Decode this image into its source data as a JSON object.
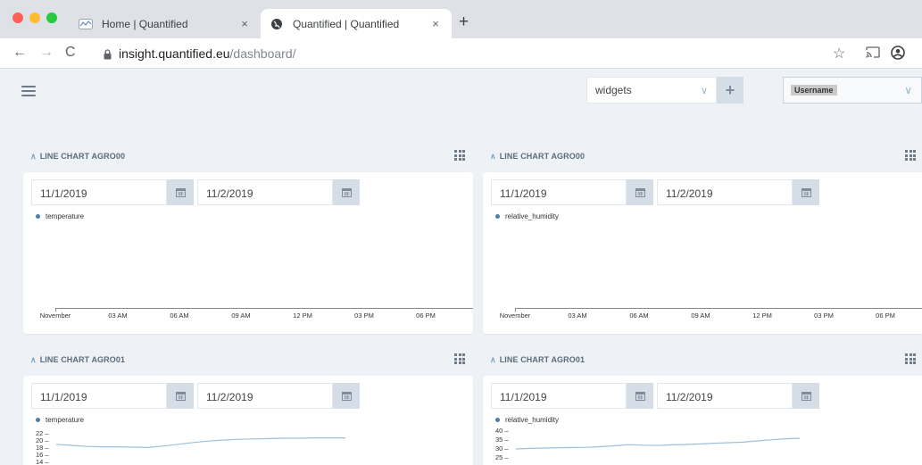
{
  "browser": {
    "tabs": [
      {
        "title": "Home | Quantified",
        "close": "×",
        "active": false
      },
      {
        "title": "Quantified | Quantified",
        "close": "×",
        "active": true
      }
    ],
    "new_tab": "+",
    "url_host": "insight.quantified.eu",
    "url_path": "/dashboard/"
  },
  "header": {
    "widget_select": {
      "value": "widgets",
      "chevron": "∨"
    },
    "add_button": "+",
    "user_select": {
      "value": "Username",
      "chevron": "∨"
    }
  },
  "widgets": [
    {
      "title": "LINE CHART AGRO00",
      "date_from": "11/1/2019",
      "date_to": "11/2/2019",
      "legend": "temperature",
      "x_ticks": [
        "November",
        "03 AM",
        "06 AM",
        "09 AM",
        "12 PM",
        "03 PM",
        "06 PM"
      ]
    },
    {
      "title": "LINE CHART AGRO00",
      "date_from": "11/1/2019",
      "date_to": "11/2/2019",
      "legend": "relative_humidity",
      "x_ticks": [
        "November",
        "03 AM",
        "06 AM",
        "09 AM",
        "12 PM",
        "03 PM",
        "06 PM"
      ]
    },
    {
      "title": "LINE CHART AGRO01",
      "date_from": "11/1/2019",
      "date_to": "11/2/2019",
      "legend": "temperature",
      "y_ticks": [
        "22 –",
        "20 –",
        "18 –",
        "16 –",
        "14 –"
      ]
    },
    {
      "title": "LINE CHART AGRO01",
      "date_from": "11/1/2019",
      "date_to": "11/2/2019",
      "legend": "relative_humidity",
      "y_ticks": [
        "40 –",
        "35 –",
        "30 –",
        "25 –"
      ]
    }
  ],
  "chart_data": [
    {
      "type": "line",
      "series": [
        {
          "name": "temperature",
          "values": []
        }
      ],
      "x": [
        "November",
        "03 AM",
        "06 AM",
        "09 AM",
        "12 PM",
        "03 PM",
        "06 PM"
      ]
    },
    {
      "type": "line",
      "series": [
        {
          "name": "relative_humidity",
          "values": []
        }
      ],
      "x": [
        "November",
        "03 AM",
        "06 AM",
        "09 AM",
        "12 PM",
        "03 PM",
        "06 PM"
      ]
    },
    {
      "type": "line",
      "series": [
        {
          "name": "temperature",
          "values": [
            18.8,
            18.5,
            18.2,
            18.1,
            18.1,
            18.0,
            17.9,
            18.3,
            18.8,
            19.3,
            19.7,
            20.0,
            20.2,
            20.3,
            20.4,
            20.5,
            20.5,
            20.6,
            20.6,
            20.6
          ]
        }
      ],
      "y_ticks": [
        22,
        20,
        18,
        16,
        14
      ]
    },
    {
      "type": "line",
      "series": [
        {
          "name": "relative_humidity",
          "values": [
            29.5,
            29.8,
            30.0,
            30.2,
            30.3,
            30.4,
            30.8,
            31.3,
            31.9,
            31.6,
            31.4,
            31.8,
            32.0,
            32.3,
            32.7,
            33.0,
            33.3,
            34.0,
            34.6,
            35.2,
            35.5
          ]
        }
      ],
      "y_ticks": [
        40,
        35,
        30,
        25
      ]
    }
  ],
  "colors": {
    "series_line": "#9cc0db",
    "legend_dot": "#4a7fa8",
    "accent_chevron": "#93b6cf",
    "page_bg": "#eef2f6"
  }
}
